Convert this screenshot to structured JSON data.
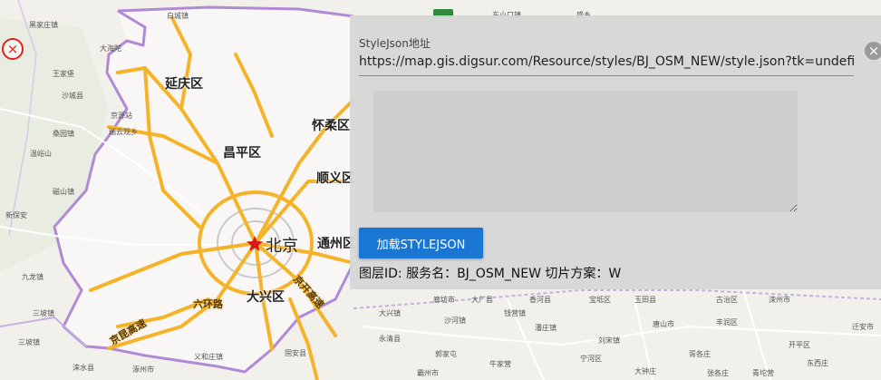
{
  "map": {
    "districts": [
      "延庆区",
      "怀柔区",
      "昌平区",
      "顺义区",
      "通州区",
      "大兴区"
    ],
    "capital": "北京",
    "road_labels": [
      "六环路",
      "京开高速",
      "京昆高速"
    ],
    "small_labels": [
      "黑家庄镇",
      "白城镇",
      "大海陀",
      "王家堡",
      "东小口镇",
      "盛乡",
      "京源站",
      "沙城县",
      "桑园镇",
      "温峪山",
      "瑞云观乡",
      "新保安",
      "磁山镇",
      "九龙镇",
      "三坡镇",
      "三坡镇",
      "涞水县",
      "涿州市",
      "义和庄镇",
      "固安县",
      "霸州市",
      "永清县",
      "廊坊市",
      "大兴镇",
      "大厂县",
      "香河县",
      "宝坻区",
      "唐山市",
      "玉田县",
      "丰润区",
      "迁安市",
      "滦州市",
      "古治区",
      "开平区",
      "胥各庄",
      "宁河区",
      "潘庄镇",
      "刘宋镇",
      "张各庄",
      "钱营镇",
      "大钟庄",
      "沙河镇",
      "郭家屯",
      "牛家营",
      "东西庄",
      "青坨营"
    ],
    "close_icon": "×"
  },
  "panel": {
    "url_label": "StyleJson地址",
    "url_value": "https://map.gis.digsur.com/Resource/styles/BJ_OSM_NEW/style.json?tk=undefined",
    "clear_icon": "×",
    "style_json_text": "",
    "load_button": "加载STYLEJSON",
    "layer_info": "图层ID: 服务名：BJ_OSM_NEW 切片方案：W"
  },
  "colors": {
    "boundary": "#b18ad6",
    "highway": "#f5b32a",
    "button": "#1976d2",
    "capital_star": "#d7191c"
  }
}
